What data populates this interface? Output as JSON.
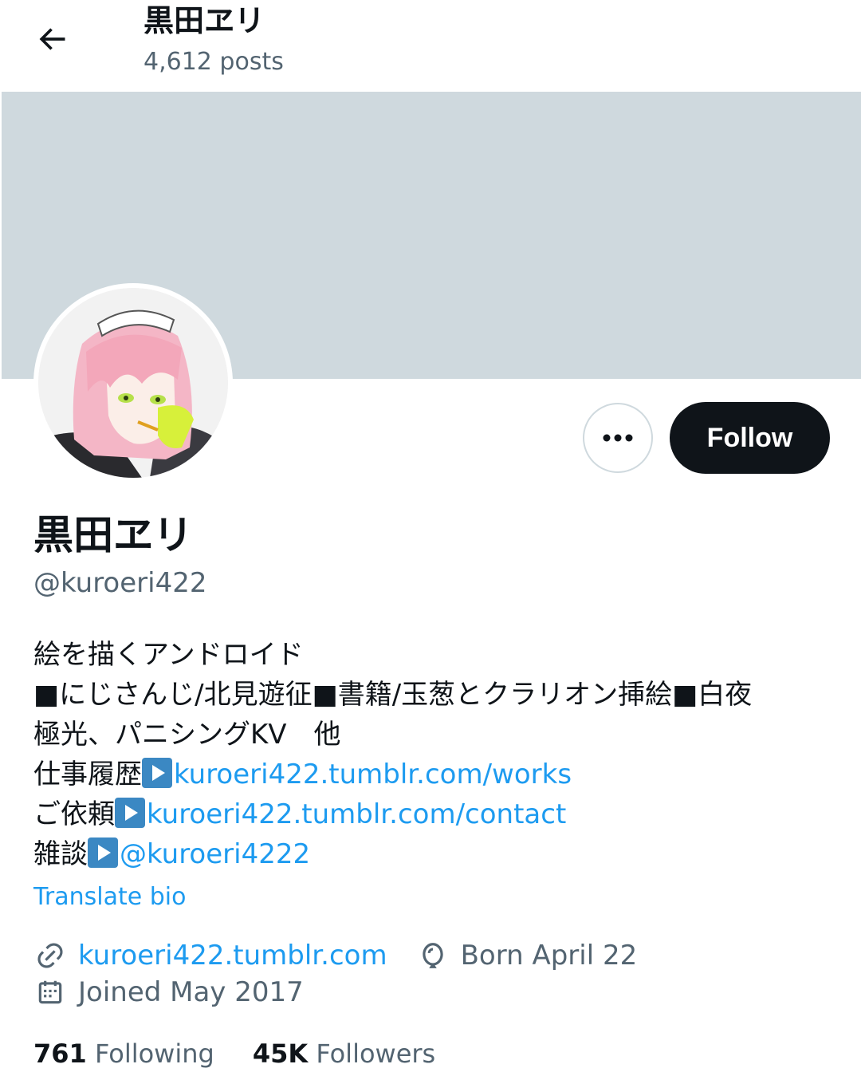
{
  "header": {
    "title": "黒田ヱリ",
    "posts": "4,612 posts"
  },
  "profile": {
    "display_name": "黒田ヱリ",
    "handle": "@kuroeri422",
    "follow_label": "Follow",
    "bio": {
      "line1": "絵を描くアンドロイド",
      "line2": "■にじさんじ/北見遊征■書籍/玉葱とクラリオン挿絵■白夜",
      "line3": "極光、パニシングKV　他",
      "line4_prefix": "仕事履歴",
      "line4_link": "kuroeri422.tumblr.com/works",
      "line5_prefix": "ご依頼",
      "line5_link": "kuroeri422.tumblr.com/contact",
      "line6_prefix": "雑談",
      "line6_link": "@kuroeri4222"
    },
    "translate_label": "Translate bio",
    "website": "kuroeri422.tumblr.com",
    "birthday": "Born April 22",
    "joined": "Joined May 2017",
    "following_count": "761",
    "following_label": "Following",
    "followers_count": "45K",
    "followers_label": "Followers"
  },
  "colors": {
    "accent": "#1d9bf0",
    "banner": "#cfd9de",
    "text_secondary": "#536471",
    "follow_button": "#0f1419"
  },
  "icons": {
    "back": "arrow-left-icon",
    "more": "more-horizontal-icon",
    "website": "link-icon",
    "birthday": "balloon-icon",
    "joined": "calendar-icon"
  }
}
